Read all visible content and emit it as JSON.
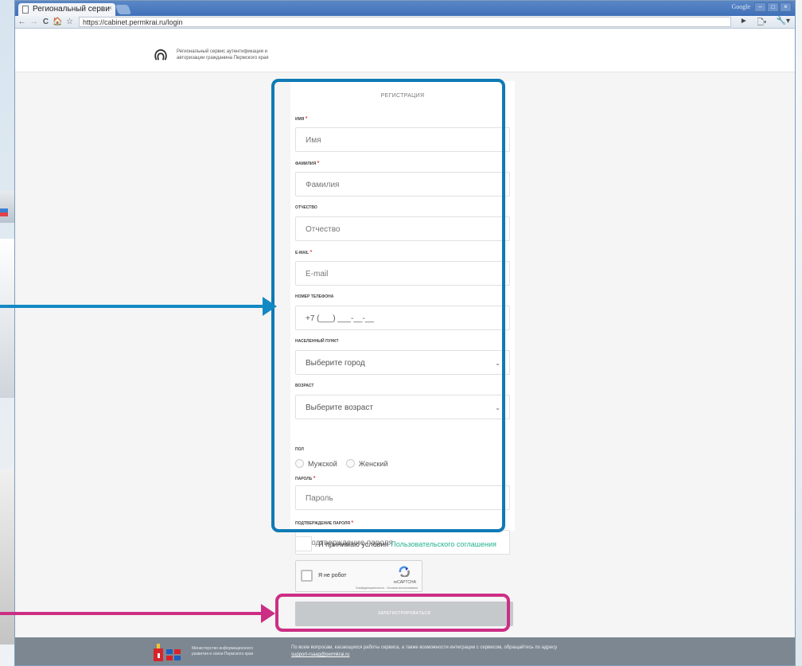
{
  "browser": {
    "tab_title": "Региональный серви",
    "tab_close": "×",
    "brand": "Google",
    "window_controls": [
      "–",
      "□",
      "×"
    ],
    "url": "https://cabinet.permkrai.ru/login",
    "nav": {
      "back": "←",
      "forward": "→",
      "reload": "C",
      "home": "🏠",
      "star": "☆"
    },
    "toolbar_right": [
      "►",
      "🗋▾",
      "🔧▾"
    ]
  },
  "header": {
    "text_line1": "Региональный сервис аутентификации и",
    "text_line2": "авторизации гражданина Пермского края"
  },
  "form": {
    "title": "РЕГИСТРАЦИЯ",
    "required_mark": "*",
    "fields": {
      "first_name": {
        "label": "ИМЯ",
        "placeholder": "Имя"
      },
      "last_name": {
        "label": "ФАМИЛИЯ",
        "placeholder": "Фамилия"
      },
      "patronymic": {
        "label": "ОТЧЕСТВО",
        "placeholder": "Отчество"
      },
      "email": {
        "label": "E-MAIL",
        "placeholder": "E-mail"
      },
      "phone": {
        "label": "НОМЕР ТЕЛЕФОНА",
        "placeholder": "+7 (___) ___-__-__"
      },
      "city": {
        "label": "НАСЕЛЕННЫЙ ПУНКТ",
        "value": "Выберите город"
      },
      "age": {
        "label": "ВОЗРАСТ",
        "value": "Выберите возраст"
      },
      "gender": {
        "label": "ПОЛ",
        "options": [
          "Мужской",
          "Женский"
        ]
      },
      "password": {
        "label": "ПАРОЛЬ",
        "placeholder": "Пароль"
      },
      "password_confirm": {
        "label": "ПОДТВЕРЖДЕНИЕ ПАРОЛЯ",
        "placeholder": "Подтверждение пароля"
      }
    },
    "chevron": "⌄",
    "agree_text": "Я принимаю условия",
    "agree_link": "Пользовательского соглашения",
    "captcha": {
      "label": "Я не робот",
      "brand": "reCAPTCHA",
      "terms": "Конфиденциальность - Условия использования"
    },
    "submit_label": "ЗАРЕГИСТРИРОВАТЬСЯ"
  },
  "footer": {
    "ministry_line1": "Министерство информационного",
    "ministry_line2": "развития и связи Пермского края",
    "info_text": "По всем вопросам, касающихся работы сервиса, а также возможности интеграции с сервисом, обращайтесь по адресу",
    "email": "support-rsaag@permkrai.ru"
  },
  "colors": {
    "highlight_blue": "#0f7ab5",
    "highlight_pink": "#cc2e84",
    "link": "#24b18f",
    "required": "#e44a4a",
    "footer_bg": "#7d8791"
  }
}
